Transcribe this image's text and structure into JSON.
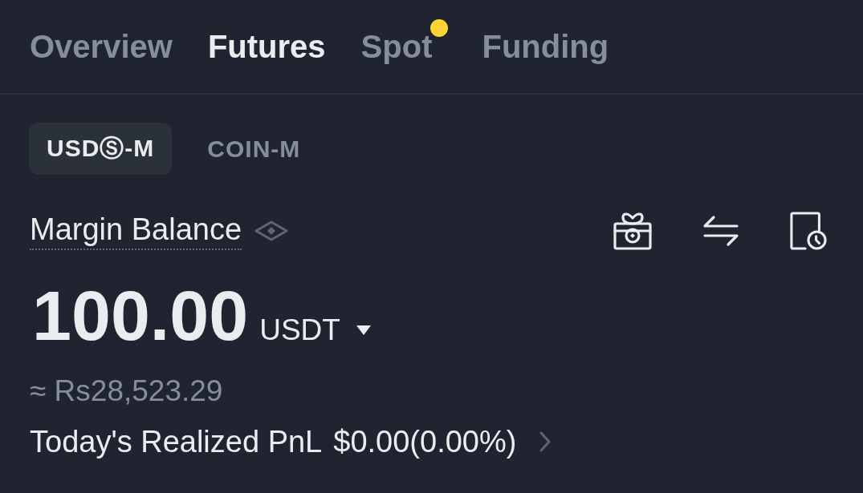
{
  "tabs": [
    {
      "label": "Overview",
      "selected": false,
      "dot": false
    },
    {
      "label": "Futures",
      "selected": true,
      "dot": false
    },
    {
      "label": "Spot",
      "selected": false,
      "dot": true
    },
    {
      "label": "Funding",
      "selected": false,
      "dot": false
    }
  ],
  "sub_tabs": [
    {
      "label": "USDⓈ-M",
      "selected": true
    },
    {
      "label": "COIN-M",
      "selected": false
    }
  ],
  "balance": {
    "label": "Margin Balance",
    "amount": "100.00",
    "currency": "USDT",
    "approx": "≈ Rs28,523.29"
  },
  "pnl": {
    "label": "Today's Realized PnL",
    "value": "$0.00(0.00%)"
  }
}
